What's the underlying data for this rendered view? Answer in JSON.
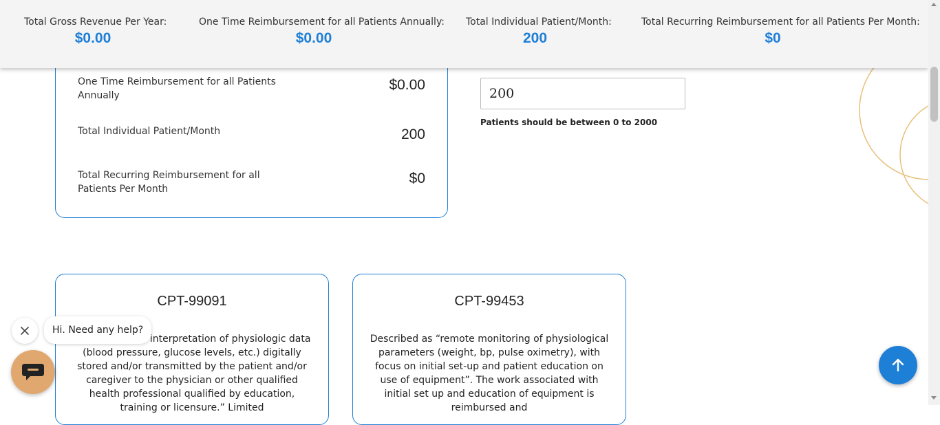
{
  "header": {
    "stats": [
      {
        "label": "Total Gross Revenue Per Year:",
        "value": "$0.00"
      },
      {
        "label": "One Time Reimbursement for all Patients Annually:",
        "value": "$0.00"
      },
      {
        "label": "Total Individual Patient/Month:",
        "value": "200"
      },
      {
        "label": "Total Recurring Reimbursement for all Patients Per Month:",
        "value": "$0"
      }
    ]
  },
  "summary": {
    "rows": [
      {
        "label": "One Time Reimbursement for all Patients Annually",
        "value": "$0.00"
      },
      {
        "label": "Total Individual Patient/Month",
        "value": "200"
      },
      {
        "label": "Total Recurring Reimbursement for all Patients Per Month",
        "value": "$0"
      }
    ]
  },
  "patients": {
    "value": "200",
    "hint": "Patients should be between 0 to 2000"
  },
  "cpt_cards": [
    {
      "title": "CPT-99091",
      "description": "“Collection and interpretation of physiologic data (blood pressure, glucose levels, etc.) digitally stored and/or transmitted by the patient and/or caregiver to the physician or other qualified health professional qualified by education, training or licensure.” Limited"
    },
    {
      "title": "CPT-99453",
      "description": "Described as “remote monitoring of physiological parameters (weight, bp, pulse oximetry), with focus on initial set-up and patient education on use of equipment”. The work associated with initial set up and education of equipment is reimbursed and"
    }
  ],
  "chat": {
    "greeting": "Hi. Need any help?"
  },
  "colors": {
    "accent": "#1e7fd6",
    "chat_button": "#e0a86e",
    "decor_arcs": "#e8c07a"
  },
  "icons": {
    "close": "close-icon",
    "chat": "chat-icon",
    "scroll_top": "arrow-up-icon"
  }
}
